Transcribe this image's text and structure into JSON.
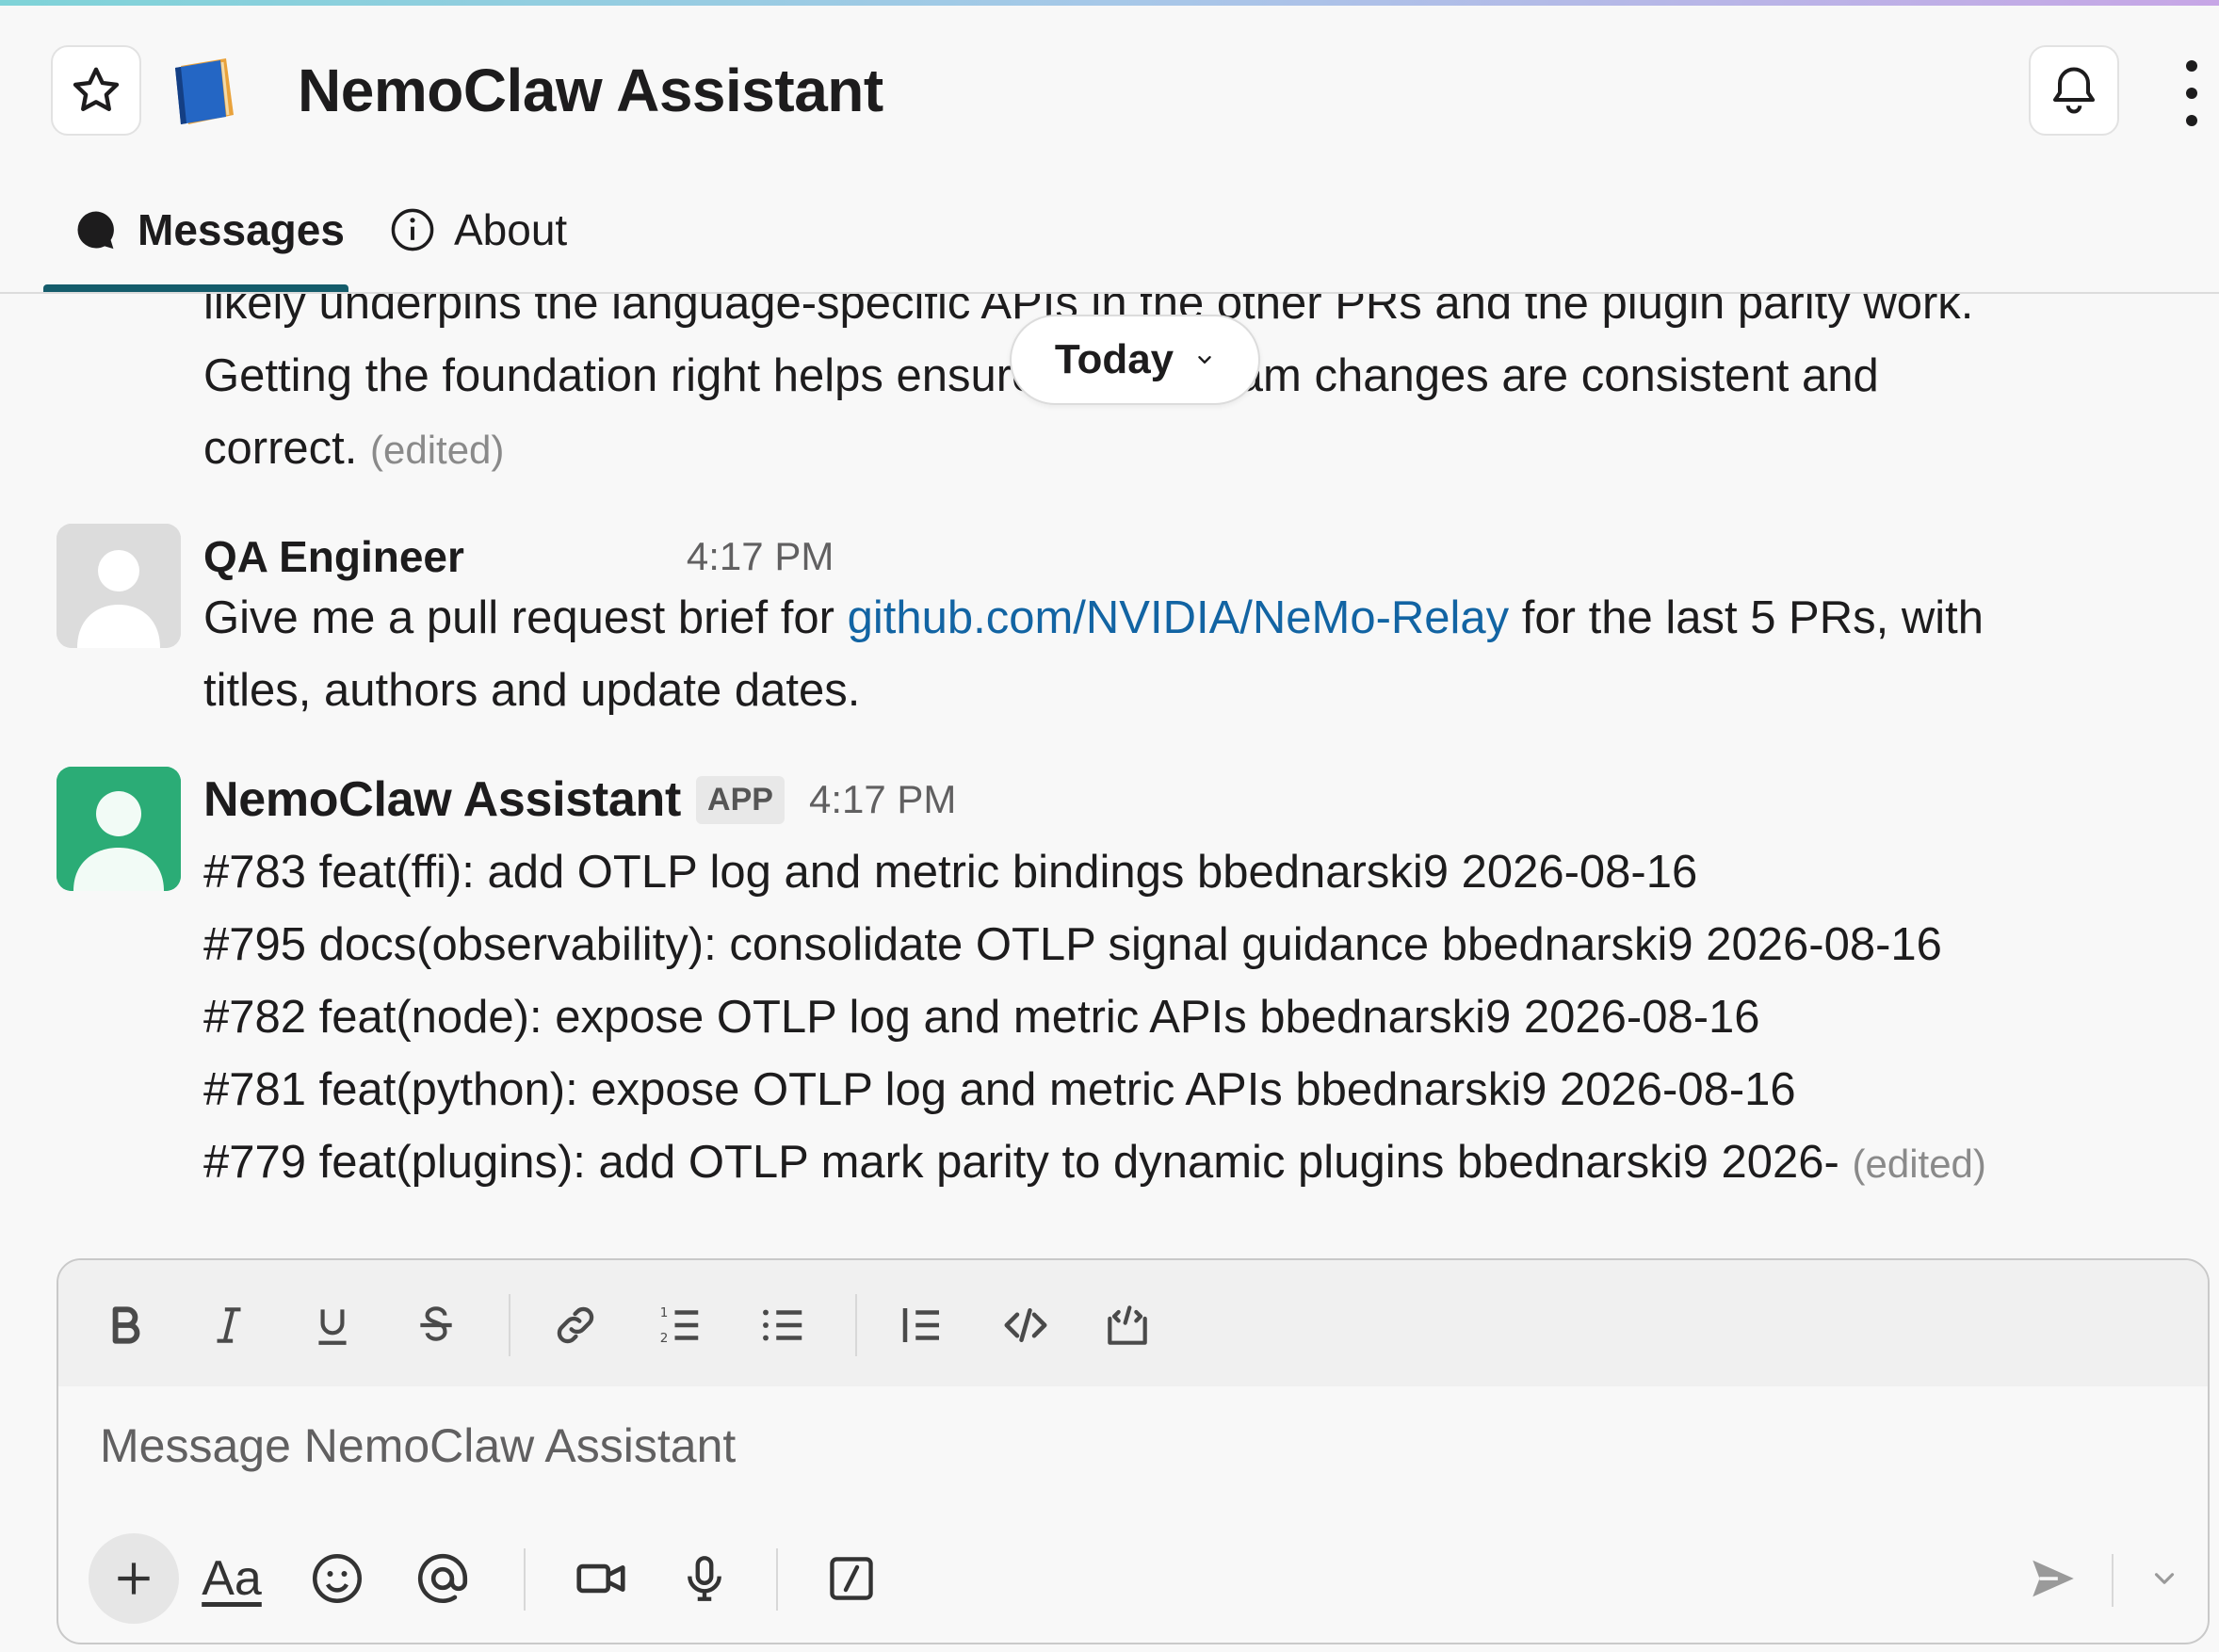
{
  "header": {
    "title": "NemoClaw Assistant"
  },
  "tabs": [
    {
      "label": "Messages",
      "active": true
    },
    {
      "label": "About",
      "active": false
    }
  ],
  "today_pill": {
    "label": "Today"
  },
  "previous_message": {
    "line1": "likely underpins the language-specific APIs in the other PRs and the plugin parity work.",
    "line2": "Getting the foundation right helps ensure downstream changes are consistent and",
    "line3": "correct.",
    "edited": "(edited)"
  },
  "messages": [
    {
      "sender": "QA Engineer",
      "time": "4:17 PM",
      "text_before_link": "Give me a pull request brief for ",
      "link": "github.com/NVIDIA/NeMo-Relay",
      "text_after_link": " for the last 5 PRs, with",
      "text_line2": "titles, authors and update dates."
    },
    {
      "sender": "NemoClaw Assistant",
      "badge": "APP",
      "time": "4:17 PM",
      "lines": [
        "#783 feat(ffi): add OTLP log and metric bindings bbednarski9 2026-08-16",
        "#795 docs(observability): consolidate OTLP signal guidance bbednarski9 2026-08-16",
        "#782 feat(node): expose OTLP log and metric APIs bbednarski9 2026-08-16",
        "#781 feat(python): expose OTLP log and metric APIs bbednarski9 2026-08-16",
        "#779 feat(plugins): add OTLP mark parity to dynamic plugins bbednarski9 2026-"
      ],
      "edited": "(edited)"
    }
  ],
  "composer": {
    "placeholder": "Message NemoClaw Assistant",
    "format_buttons": [
      "bold",
      "italic",
      "underline",
      "strikethrough",
      "link",
      "ordered-list",
      "bulleted-list",
      "blockquote",
      "code",
      "code-block"
    ],
    "text_format_label": "Aa"
  },
  "colors": {
    "link": "#1264a3",
    "active_tab_underline": "#145c6b",
    "app_avatar": "#2bac76"
  }
}
